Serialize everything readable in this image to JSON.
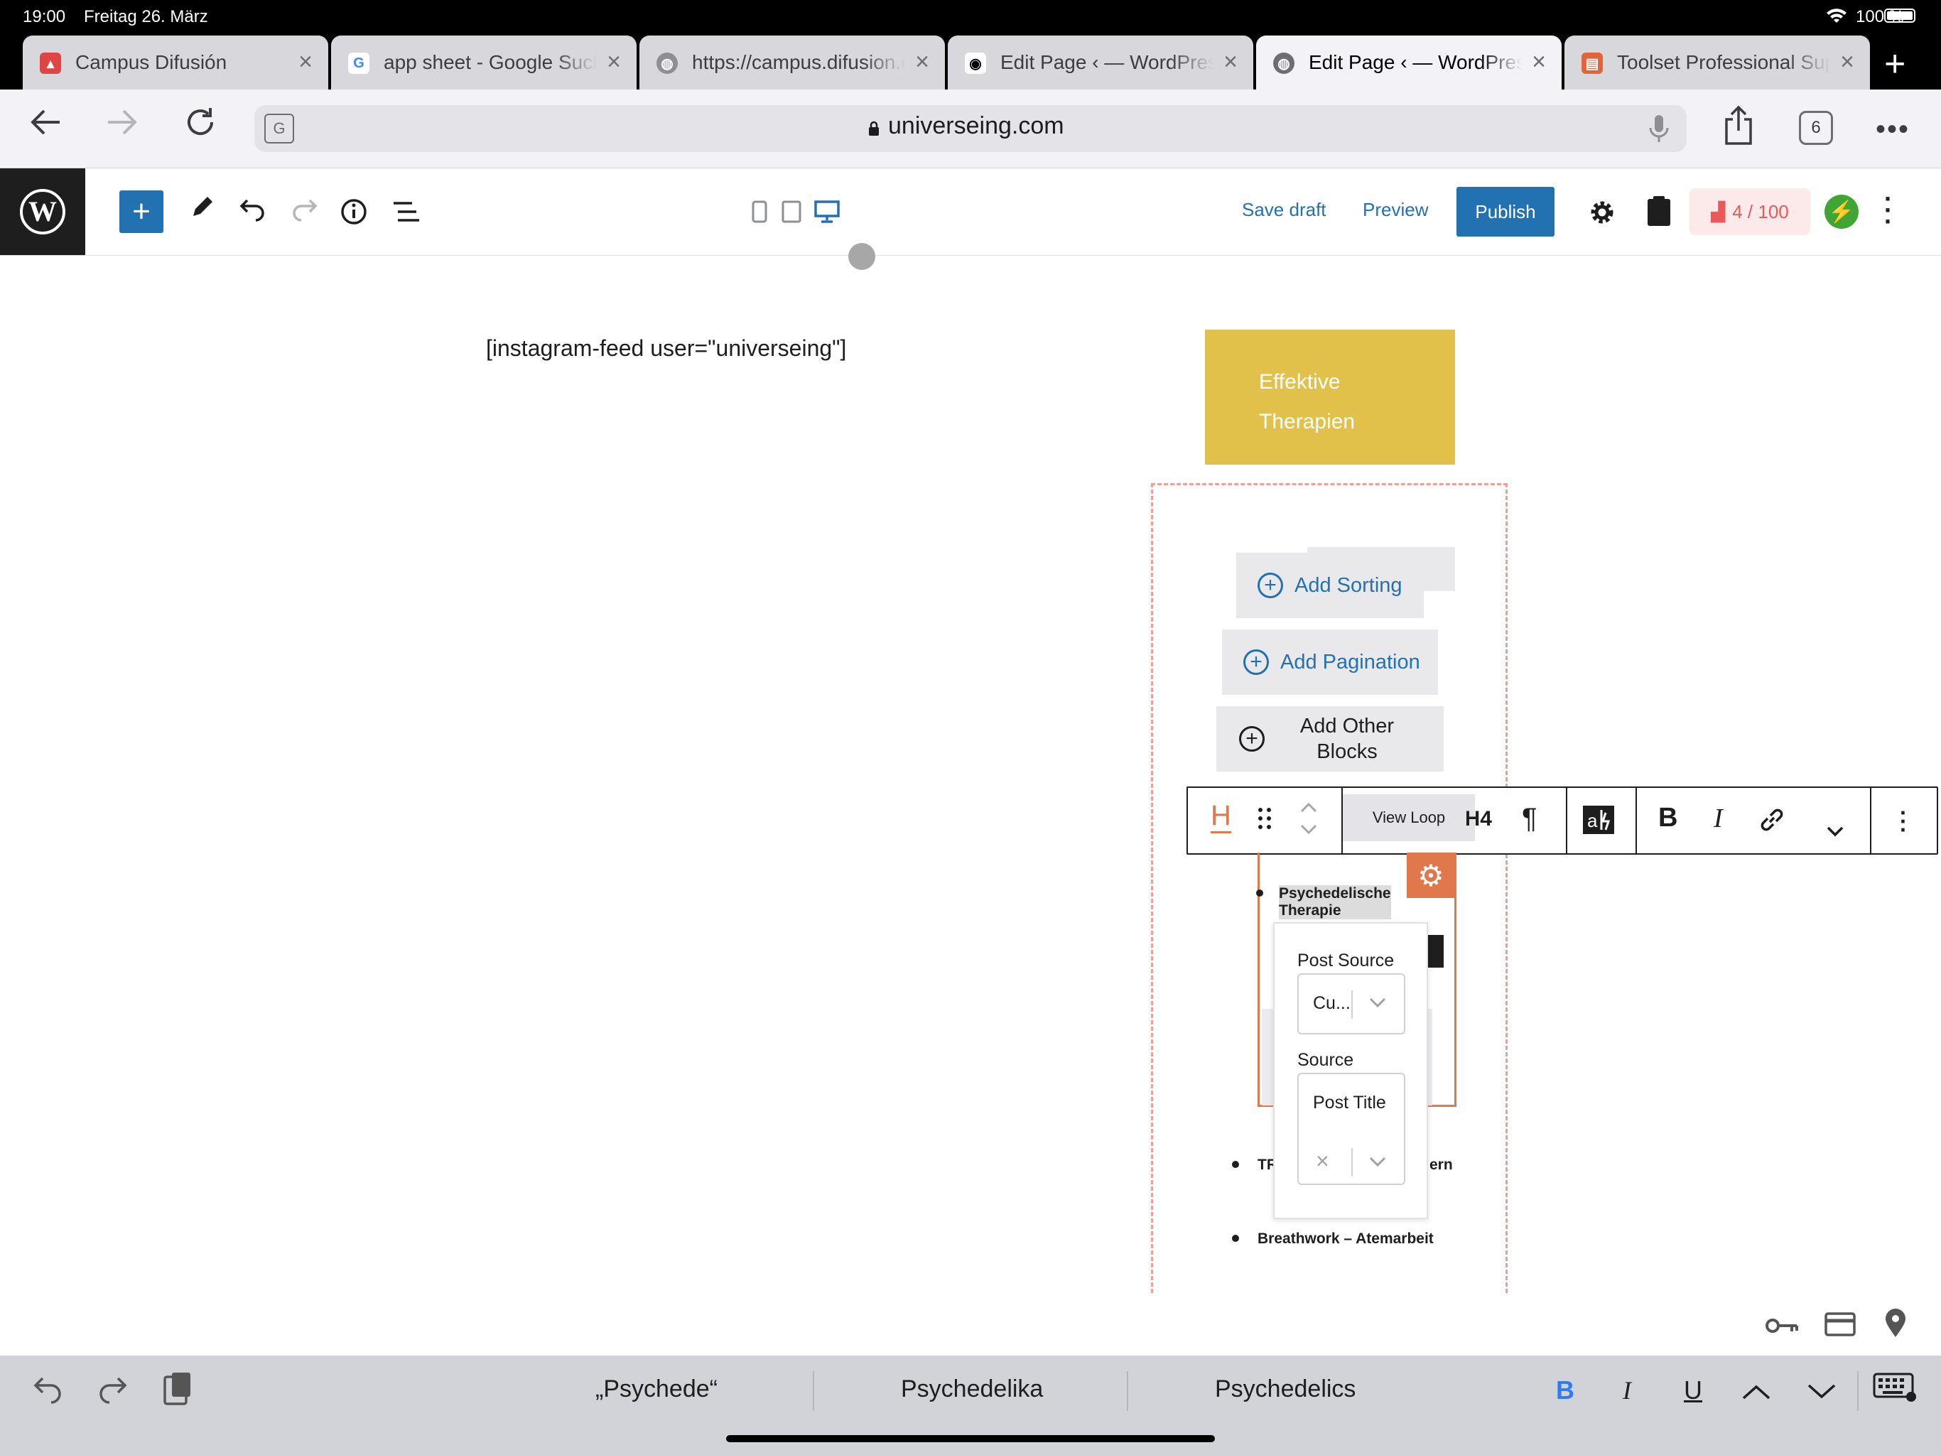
{
  "status_bar": {
    "time": "19:00",
    "date": "Freitag 26. März",
    "battery": "100 %"
  },
  "tabs": [
    {
      "label": "Campus Difusión",
      "favicon": "campus-favicon",
      "active": false
    },
    {
      "label": "app sheet - Google Suche",
      "favicon": "google-favicon",
      "active": false
    },
    {
      "label": "https://campus.difusion.com",
      "favicon": "globe-favicon",
      "active": false
    },
    {
      "label": "Edit Page ‹ — WordPress",
      "favicon": "eye-favicon",
      "active": false
    },
    {
      "label": "Edit Page ‹ — WordPress",
      "favicon": "globe-favicon",
      "active": true
    },
    {
      "label": "Toolset Professional Support",
      "favicon": "toolset-favicon",
      "active": false
    }
  ],
  "address_bar": {
    "url": "universeing.com",
    "tab_count": "6"
  },
  "wp_toolbar": {
    "save_draft": "Save draft",
    "preview": "Preview",
    "publish": "Publish",
    "score": "4 / 100"
  },
  "canvas": {
    "shortcode": "[instagram-feed user=\"universeing\"]",
    "yellow_box": {
      "line1": "Effektive",
      "line2": "Therapien",
      "color": "#e1c14a"
    },
    "add_sorting": "Add Sorting",
    "add_pagination": "Add Pagination",
    "add_other_line1": "Add Other",
    "add_other_line2": "Blocks"
  },
  "block_toolbar": {
    "heading_icon": "H",
    "view_loop": "View Loop",
    "heading_level": "H4",
    "bold": "B",
    "italic": "I"
  },
  "list_items": {
    "item1_line1": "Psychedelische",
    "item1_line2": "Therapie",
    "item2_start": "TR",
    "item2_end": "ern",
    "item3": "Breathwork – Atemarbeit"
  },
  "popover": {
    "post_source_label": "Post Source",
    "post_source_value": "Cu...",
    "source_label": "Source",
    "source_value": "Post Title"
  },
  "keyboard_bar": {
    "suggestions": [
      "„Psychede“",
      "Psychedelika",
      "Psychedelics"
    ],
    "bold": "B",
    "italic": "I",
    "underline": "U"
  },
  "colors": {
    "wp_blue": "#2271b1",
    "accent_orange": "#e1784b",
    "dashed_border": "#f0a096"
  }
}
